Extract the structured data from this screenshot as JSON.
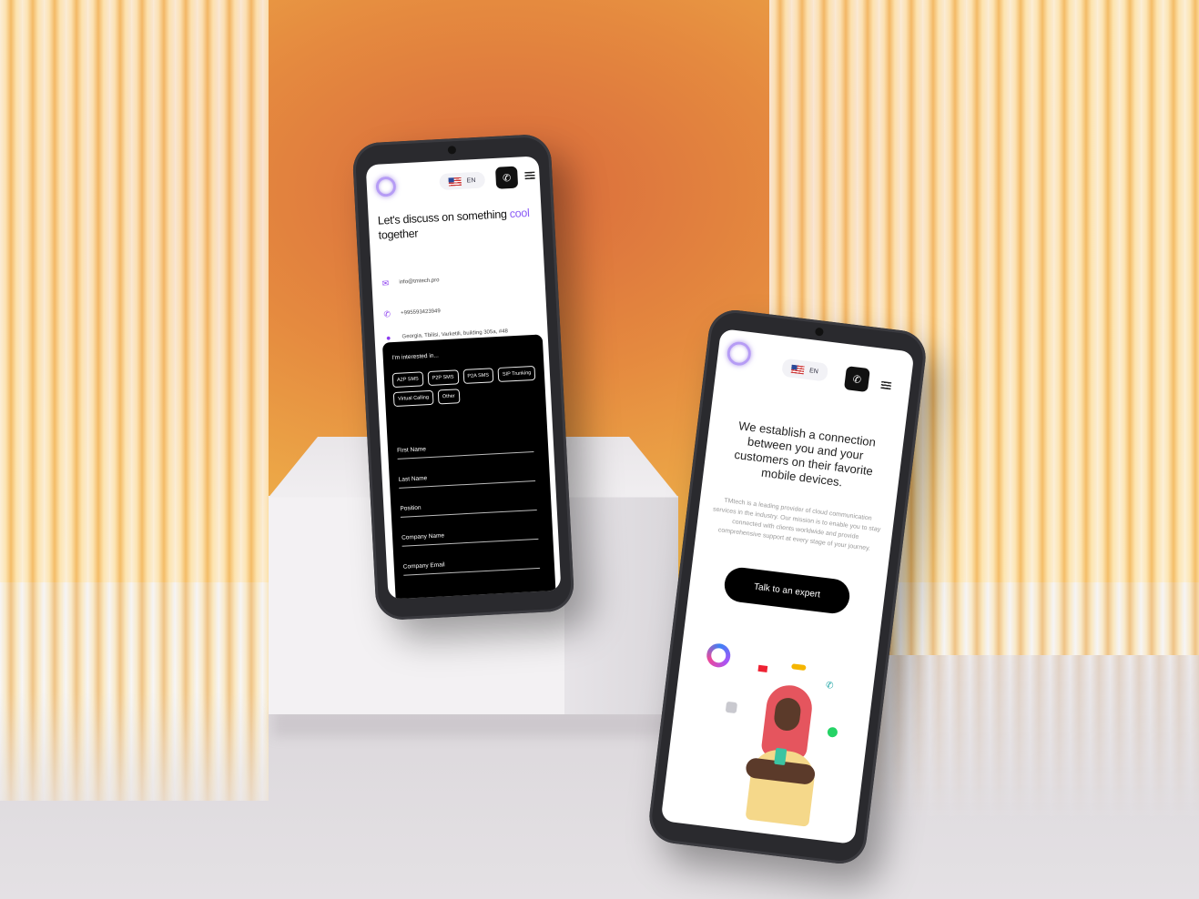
{
  "phone_left": {
    "header": {
      "language": "EN"
    },
    "heading_prefix": "Let's discuss on something",
    "heading_accent": "cool",
    "heading_suffix": "together",
    "contact": {
      "email": "info@tmtech.pro",
      "phone": "+995593423949",
      "address": "Georgia, Tbilisi, Varketili, building 305a, #48"
    },
    "form": {
      "interested_label": "I'm interested in...",
      "options": [
        "A2P SMS",
        "P2P SMS",
        "P2A SMS",
        "SIP Trunking",
        "Virtual Calling",
        "Other"
      ],
      "fields": [
        "First Name",
        "Last Name",
        "Position",
        "Company Name",
        "Company Email"
      ]
    },
    "colors": {
      "accent": "#8b5cf6",
      "card": "#000000"
    }
  },
  "phone_right": {
    "header": {
      "language": "EN"
    },
    "heading": "We establish a connection between you and your customers on their favorite mobile devices.",
    "subtext": "TMtech is a leading provider of cloud communication services in the industry. Our mission is to enable you to stay connected with clients worldwide and provide comprehensive support at every stage of your journey.",
    "cta_label": "Talk to an expert",
    "illustration_icons": [
      "messenger-icon",
      "mail-icon",
      "chat-icon",
      "phone-icon",
      "whatsapp-icon",
      "robot-icon"
    ]
  }
}
